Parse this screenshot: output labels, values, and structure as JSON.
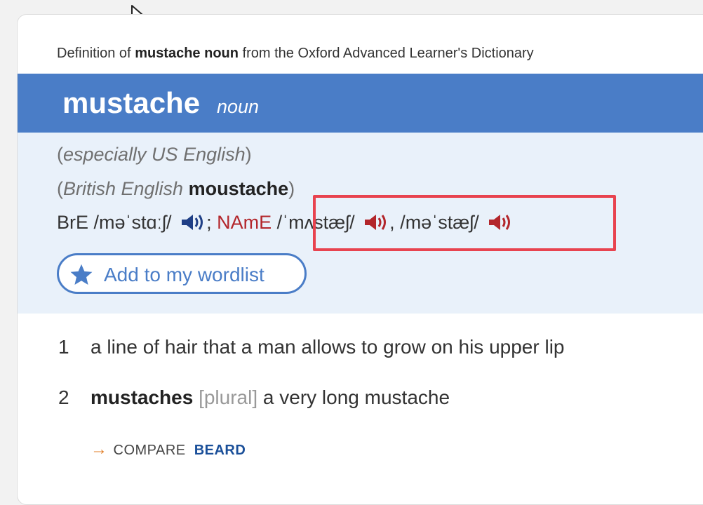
{
  "source_line": {
    "prefix": "Definition of",
    "entry": "mustache noun",
    "suffix": "from the Oxford Advanced Learner's Dictionary"
  },
  "headword": {
    "word": "mustache",
    "part_of_speech": "noun"
  },
  "top_group": {
    "label_1": "especially US English",
    "label_2": "British English",
    "variant": "moustache",
    "bre_label": "BrE",
    "bre_pron": "/məˈstɑːʃ/",
    "separator": ";",
    "name_label": "NAmE",
    "name_pron_1": "/ˈmʌstæʃ/",
    "name_pron_2": "/məˈstæʃ/",
    "comma": ","
  },
  "wordlist_button": {
    "label": "Add to my wordlist"
  },
  "senses": [
    {
      "num": "1",
      "text": "a line of hair that a man allows to grow on his upper lip"
    },
    {
      "num": "2",
      "variant": "mustaches",
      "grammar": "[plural]",
      "text": "a very long mustache"
    }
  ],
  "compare": {
    "label": "COMPARE",
    "xref": "BEARD"
  },
  "colors": {
    "banner": "#4a7dc7",
    "name_red": "#b3262b",
    "bre_blue": "#1f3f86",
    "highlight": "#e8434f",
    "arrow": "#e07c25"
  }
}
